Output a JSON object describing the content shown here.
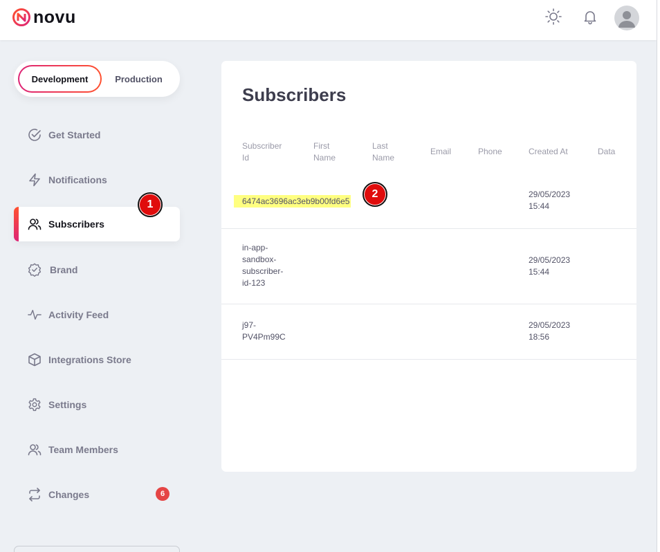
{
  "brand": {
    "name": "novu"
  },
  "header": {
    "icons": [
      "sun-icon",
      "bell-icon",
      "avatar"
    ]
  },
  "env": {
    "development": "Development",
    "production": "Production"
  },
  "sidebar": {
    "items": [
      {
        "label": "Get Started",
        "icon": "check-circle-icon"
      },
      {
        "label": "Notifications",
        "icon": "lightning-icon"
      },
      {
        "label": "Subscribers",
        "icon": "users-icon",
        "active": true
      },
      {
        "label": "Brand",
        "icon": "badge-check-icon"
      },
      {
        "label": "Activity Feed",
        "icon": "activity-icon"
      },
      {
        "label": "Integrations Store",
        "icon": "box-icon"
      },
      {
        "label": "Settings",
        "icon": "gear-icon"
      },
      {
        "label": "Team Members",
        "icon": "users-icon"
      },
      {
        "label": "Changes",
        "icon": "swap-icon",
        "badge": "6"
      }
    ]
  },
  "markers": {
    "one": "1",
    "two": "2"
  },
  "main": {
    "title": "Subscribers",
    "columns": [
      "Subscriber Id",
      "First Name",
      "Last Name",
      "Email",
      "Phone",
      "Created At",
      "Data"
    ],
    "rows": [
      {
        "id": "6474ac3696ac3eb9b00fd6e5",
        "created": "29/05/2023 15:44"
      },
      {
        "id": "in-app-sandbox-subscriber-id-123",
        "created": "29/05/2023 15:44"
      },
      {
        "id": "j97-PV4Pm99C",
        "created": "29/05/2023 18:56"
      }
    ]
  },
  "colors": {
    "accent_start": "#ff512f",
    "accent_end": "#dd2476",
    "badge": "#e54545"
  }
}
